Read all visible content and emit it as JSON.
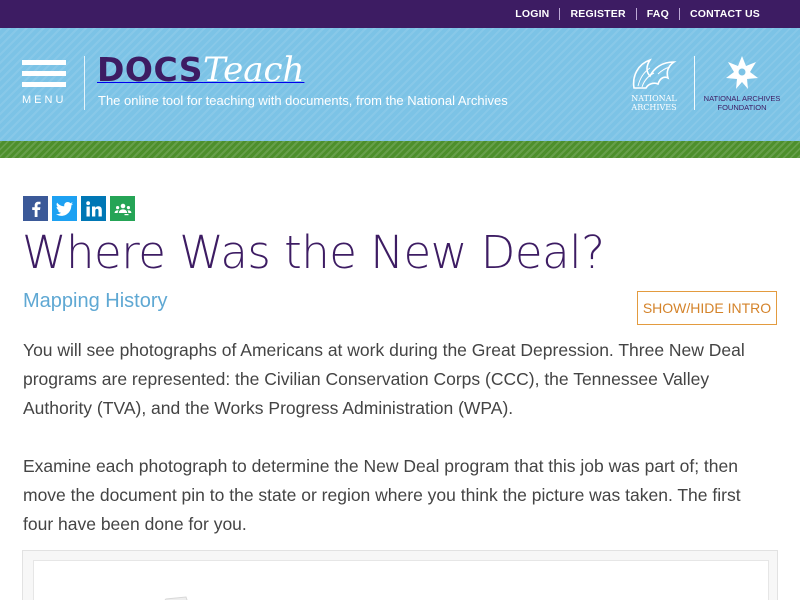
{
  "topnav": {
    "login": "LOGIN",
    "register": "REGISTER",
    "faq": "FAQ",
    "contact": "CONTACT US"
  },
  "header": {
    "menu_label": "MENU",
    "logo_docs": "DOCS",
    "logo_teach": "Teach",
    "tagline": "The online tool for teaching with documents, from the National Archives",
    "archives_line1": "NATIONAL",
    "archives_line2": "ARCHIVES",
    "foundation_line1": "NATIONAL ARCHIVES",
    "foundation_line2": "FOUNDATION"
  },
  "share": {
    "icons": [
      "facebook-icon",
      "twitter-icon",
      "linkedin-icon",
      "google-classroom-icon"
    ]
  },
  "activity": {
    "title": "Where Was the New Deal?",
    "subtitle": "Mapping History",
    "toggle_label": "SHOW/HIDE INTRO",
    "paragraphs": [
      "You will see photographs of Americans at work during the Great Depression. Three New Deal programs are represented: the Civilian Conservation Corps (CCC), the Tennessee Valley Authority (TVA), and the Works Progress Administration (WPA).",
      "Examine each photograph to determine the New Deal program that this job was part of; then move the document pin to the state or region where you think the picture was taken. The first four have been done for you."
    ]
  },
  "colors": {
    "topbar": "#3d1c63",
    "header": "#7cc3e6",
    "green_stripe": "#4d8f2c",
    "title": "#3d1c63",
    "subtitle": "#5fa8d3",
    "button_border": "#e39b3f"
  }
}
